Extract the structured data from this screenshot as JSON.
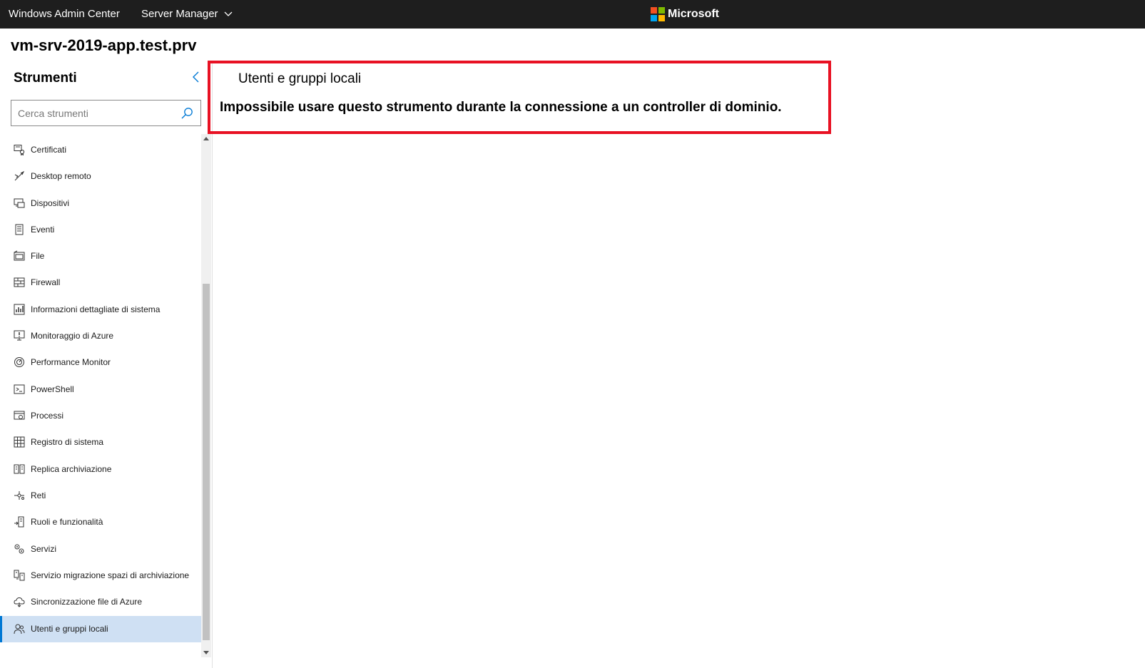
{
  "topbar": {
    "app_title": "Windows Admin Center",
    "server_manager_label": "Server Manager",
    "brand_text": "Microsoft",
    "logo_colors": [
      "#f25022",
      "#7fba00",
      "#00a4ef",
      "#ffb900"
    ]
  },
  "server_name": "vm-srv-2019-app.test.prv",
  "sidebar": {
    "title": "Strumenti",
    "search_placeholder": "Cerca strumenti",
    "items": [
      {
        "label": "Certificati",
        "icon": "certificate-icon"
      },
      {
        "label": "Desktop remoto",
        "icon": "remote-desktop-icon"
      },
      {
        "label": "Dispositivi",
        "icon": "devices-icon"
      },
      {
        "label": "Eventi",
        "icon": "events-icon"
      },
      {
        "label": "File",
        "icon": "file-icon"
      },
      {
        "label": "Firewall",
        "icon": "firewall-icon"
      },
      {
        "label": "Informazioni dettagliate di sistema",
        "icon": "system-insights-icon"
      },
      {
        "label": "Monitoraggio di Azure",
        "icon": "azure-monitor-icon"
      },
      {
        "label": "Performance Monitor",
        "icon": "performance-monitor-icon"
      },
      {
        "label": "PowerShell",
        "icon": "powershell-icon"
      },
      {
        "label": "Processi",
        "icon": "processes-icon"
      },
      {
        "label": "Registro di sistema",
        "icon": "registry-icon"
      },
      {
        "label": "Replica archiviazione",
        "icon": "storage-replica-icon"
      },
      {
        "label": "Reti",
        "icon": "network-icon"
      },
      {
        "label": "Ruoli e funzionalità",
        "icon": "roles-features-icon"
      },
      {
        "label": "Servizi",
        "icon": "services-icon"
      },
      {
        "label": "Servizio migrazione spazi di archiviazione",
        "icon": "storage-migration-icon"
      },
      {
        "label": "Sincronizzazione file di Azure",
        "icon": "azure-file-sync-icon"
      },
      {
        "label": "Utenti e gruppi locali",
        "icon": "users-groups-icon",
        "selected": true
      }
    ]
  },
  "main": {
    "title": "Utenti e gruppi locali",
    "message": "Impossibile usare questo strumento durante la connessione a un controller di dominio.",
    "highlight_color": "#e81123"
  },
  "colors": {
    "topbar_bg": "#1e1e1e",
    "selected_bg": "#cfe0f3",
    "accent": "#0078d4"
  }
}
